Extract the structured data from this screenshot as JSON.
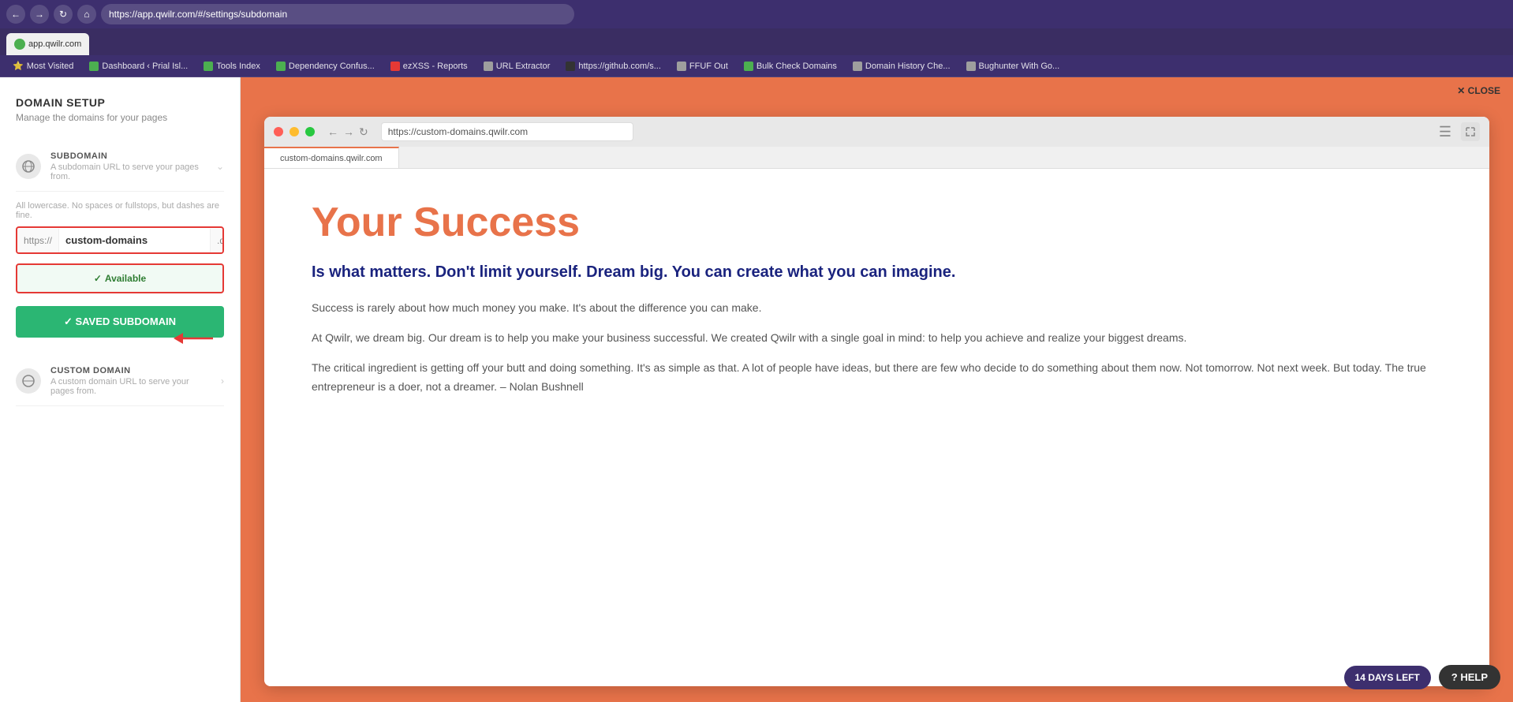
{
  "browser": {
    "url": "https://app.qwilr.com/#/settings/subdomain",
    "tabs": [
      {
        "label": "Dashboard ‹ Prial Isl...",
        "favicon_color": "#4CAF50",
        "active": true
      },
      {
        "label": "Tools Index",
        "favicon_color": "#4CAF50",
        "active": false
      },
      {
        "label": "Dependency Confus...",
        "favicon_color": "#4CAF50",
        "active": false
      },
      {
        "label": "ezXSS - Reports",
        "favicon_color": "#9E9E9E",
        "active": false
      },
      {
        "label": "URL Extractor",
        "favicon_color": "#9E9E9E",
        "active": false
      },
      {
        "label": "https://github.com/s...",
        "favicon_color": "#9E9E9E",
        "active": false
      },
      {
        "label": "FFUF Out",
        "favicon_color": "#9E9E9E",
        "active": false
      },
      {
        "label": "Bulk Check Domains",
        "favicon_color": "#4CAF50",
        "active": false
      },
      {
        "label": "Domain History Che...",
        "favicon_color": "#9E9E9E",
        "active": false
      },
      {
        "label": "Bughunter With Go...",
        "favicon_color": "#9E9E9E",
        "active": false
      }
    ],
    "bookmarks": [
      {
        "label": "Most Visited",
        "favicon_color": "#9E9E9E"
      },
      {
        "label": "Dashboard ‹ Prial Isl...",
        "favicon_color": "#4CAF50"
      },
      {
        "label": "Tools Index",
        "favicon_color": "#4CAF50"
      },
      {
        "label": "Dependency Confus...",
        "favicon_color": "#4CAF50"
      },
      {
        "label": "ezXSS - Reports",
        "favicon_color": "#9E9E9E"
      },
      {
        "label": "URL Extractor",
        "favicon_color": "#9E9E9E"
      },
      {
        "label": "https://github.com/s...",
        "favicon_color": "#9E9E9E"
      },
      {
        "label": "FFUF Out",
        "favicon_color": "#9E9E9E"
      },
      {
        "label": "Bulk Check Domains",
        "favicon_color": "#4CAF50"
      },
      {
        "label": "Domain History Che...",
        "favicon_color": "#9E9E9E"
      },
      {
        "label": "Bughunter With Go...",
        "favicon_color": "#9E9E9E"
      }
    ]
  },
  "sidebar": {
    "title": "DOMAIN SETUP",
    "subtitle": "Manage the domains for your pages",
    "subdomain": {
      "label": "SUBDOMAIN",
      "description": "A subdomain URL to serve your pages from.",
      "hint": "All lowercase. No spaces or fullstops, but dashes are fine.",
      "prefix": "https://",
      "value": "custom-domains",
      "suffix": ".qwilr.com",
      "available_label": "✓  Available",
      "save_label": "✓  SAVED SUBDOMAIN"
    },
    "custom_domain": {
      "label": "CUSTOM DOMAIN",
      "description": "A custom domain URL to serve your pages from."
    }
  },
  "preview": {
    "close_label": "✕  CLOSE",
    "url": "https://custom-domains.qwilr.com",
    "heading": "Your Success",
    "subheading": "Is what matters. Don't limit yourself. Dream big. You can create what you can imagine.",
    "body1": "Success is rarely about how much money you make. It's about the difference you can make.",
    "body2": "At Qwilr, we dream big. Our dream is to help you make your business successful. We created Qwilr with a single goal in mind: to help you achieve and realize your biggest dreams.",
    "body3": "The critical ingredient is getting off your butt and doing something. It's as simple as that. A lot of people have ideas, but there are few who decide to do something about them now. Not tomorrow. Not next week. But today. The true entrepreneur is a doer, not a dreamer. – Nolan Bushnell"
  },
  "bottom_bar": {
    "days_left": "14 DAYS LEFT",
    "help_label": "? HELP"
  }
}
